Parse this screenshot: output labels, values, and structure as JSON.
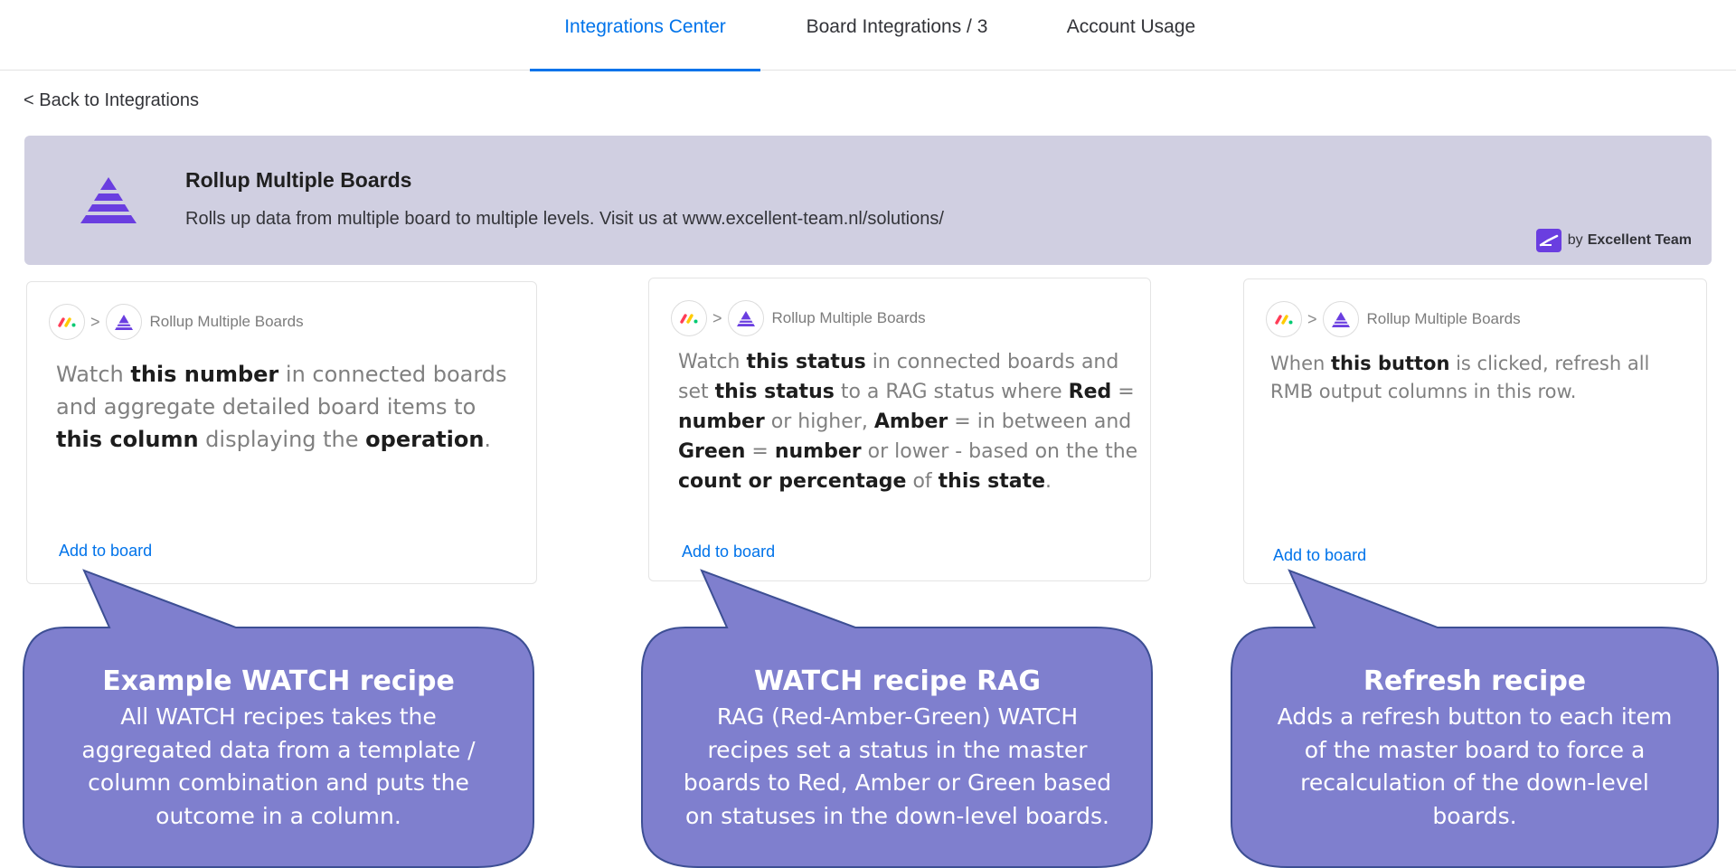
{
  "tabs": [
    {
      "label": "Integrations Center",
      "active": true
    },
    {
      "label": "Board Integrations / 3",
      "active": false
    },
    {
      "label": "Account Usage",
      "active": false
    }
  ],
  "back_link": "< Back to Integrations",
  "app": {
    "title": "Rollup Multiple Boards",
    "description": "Rolls up data from multiple board to multiple levels. Visit us at www.excellent-team.nl/solutions/",
    "by_prefix": "by",
    "vendor": "Excellent Team",
    "logo_icon": "pyramid-icon",
    "accent_color": "#6a3ee0"
  },
  "cards": [
    {
      "crumb_label": "Rollup Multiple Boards",
      "recipe_parts": [
        "Watch ",
        "this number",
        " in connected boards and aggregate detailed board items to ",
        "this column",
        " displaying the ",
        "operation",
        "."
      ],
      "add_label": "Add to board"
    },
    {
      "crumb_label": "Rollup Multiple Boards",
      "recipe_parts": [
        "Watch ",
        "this status",
        " in connected boards and set ",
        "this status",
        " to a RAG status where ",
        "Red",
        " = ",
        "number",
        " or higher, ",
        "Amber",
        " = in between and ",
        "Green",
        " = ",
        "number",
        " or lower - based on the the ",
        "count or percentage",
        " of ",
        "this state",
        "."
      ],
      "add_label": "Add to board"
    },
    {
      "crumb_label": "Rollup Multiple Boards",
      "recipe_parts": [
        "When ",
        "this button",
        " is clicked, refresh all RMB output columns in this row."
      ],
      "add_label": "Add to board"
    }
  ],
  "callouts": [
    {
      "title": "Example WATCH recipe",
      "lines": [
        "All WATCH recipes takes the",
        "aggregated data from a template /",
        "column combination and puts the",
        "outcome in a column."
      ]
    },
    {
      "title": "WATCH recipe RAG",
      "lines": [
        "RAG (Red-Amber-Green) WATCH",
        "recipes set a status in the master",
        "boards to Red, Amber or Green based",
        "on statuses in the down-level boards."
      ]
    },
    {
      "title": "Refresh recipe",
      "lines": [
        "Adds a refresh button to each item",
        "of the master board to force a",
        "recalculation of the down-level",
        "boards."
      ]
    }
  ],
  "colors": {
    "tab_active": "#0073ea",
    "banner_bg": "#d0cfe1",
    "callout_fill": "#7f7fce",
    "callout_stroke": "#3d4f94",
    "monday_red": "#ff3d57",
    "monday_yellow": "#ffcb00",
    "monday_green": "#00ca72"
  }
}
